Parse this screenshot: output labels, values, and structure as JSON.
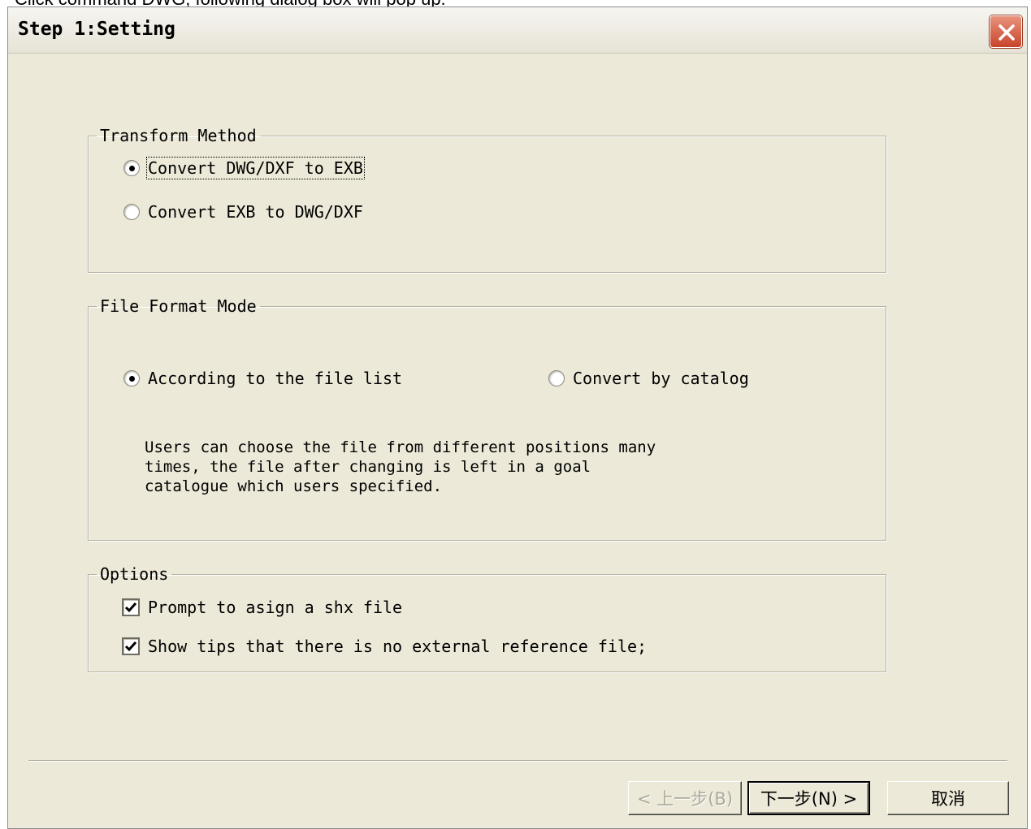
{
  "caption": "Click command DWG, following dialog box will pop up.",
  "dialog": {
    "title": "Step 1:Setting",
    "close_icon": "close-icon"
  },
  "transform_method": {
    "label": "Transform Method",
    "options": [
      {
        "label": "Convert DWG/DXF to EXB",
        "checked": true
      },
      {
        "label": "Convert EXB to DWG/DXF",
        "checked": false
      }
    ]
  },
  "file_format_mode": {
    "label": "File Format Mode",
    "options": [
      {
        "label": "According to the file list",
        "checked": true
      },
      {
        "label": "Convert by catalog",
        "checked": false
      }
    ],
    "description": [
      "Users can choose the file from different positions many",
      "times, the file after changing is left in a goal",
      "catalogue which users specified."
    ]
  },
  "options_group": {
    "label": "Options",
    "items": [
      {
        "label": "Prompt to asign a shx file",
        "checked": true
      },
      {
        "label": "Show tips that there is no external reference file;",
        "checked": true
      }
    ]
  },
  "buttons": {
    "back": "< 上一步(B)",
    "next": "下一步(N) >",
    "cancel": "取消"
  }
}
